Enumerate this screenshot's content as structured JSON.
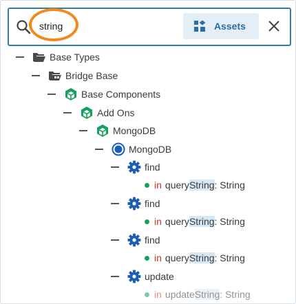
{
  "search": {
    "value": "string"
  },
  "assets_button": {
    "label": "Assets"
  },
  "tree": [
    {
      "kind": "folder",
      "label": "Base Types"
    },
    {
      "kind": "folder-grid",
      "label": "Bridge Base"
    },
    {
      "kind": "cube",
      "label": "Base Components"
    },
    {
      "kind": "cube",
      "label": "Add Ons"
    },
    {
      "kind": "cube",
      "label": "MongoDB"
    },
    {
      "kind": "service",
      "label": "MongoDB"
    },
    {
      "kind": "gear",
      "label": "find"
    },
    {
      "kind": "param",
      "direction": "in",
      "name_prefix": "query",
      "name_match": "String",
      "type": ": String"
    },
    {
      "kind": "gear",
      "label": "find"
    },
    {
      "kind": "param",
      "direction": "in",
      "name_prefix": "query",
      "name_match": "String",
      "type": ": String"
    },
    {
      "kind": "gear",
      "label": "find"
    },
    {
      "kind": "param",
      "direction": "in",
      "name_prefix": "query",
      "name_match": "String",
      "type": ": String"
    },
    {
      "kind": "gear",
      "label": "update"
    },
    {
      "kind": "param",
      "direction": "in",
      "name_prefix": "update",
      "name_match": "String",
      "type": ": String"
    }
  ],
  "colors": {
    "accent": "#2e7ea8",
    "icon_green": "#16a05d",
    "icon_blue": "#1a5fb4",
    "in_red": "#c0392b",
    "highlight_ring": "#f08a1f"
  }
}
